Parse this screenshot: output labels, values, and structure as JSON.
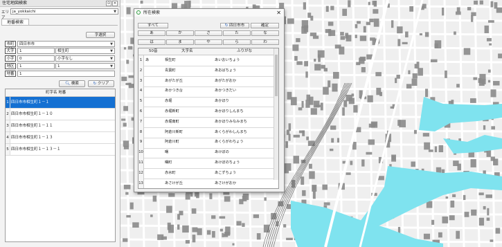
{
  "panel": {
    "title": "住宅地図検索",
    "area_label": "エリア",
    "area_value": "ja_yokkaichi",
    "tab_label": "地番検索",
    "char_select_label": "字選択",
    "rows": [
      {
        "label": "市町村",
        "value": "四日市市",
        "sub": ""
      },
      {
        "label": "大字",
        "value": "1",
        "sub": "相生町"
      },
      {
        "label": "小字",
        "value": "0",
        "sub": "小字なし"
      },
      {
        "label": "地区",
        "value": "1",
        "sub": "1"
      },
      {
        "label": "地番",
        "value": "1",
        "sub": ""
      }
    ],
    "search_label": "検索",
    "clear_label": "クリア",
    "results_header": "町字名  地番",
    "results": [
      {
        "n": "1",
        "text": "四日市市相生町１－１"
      },
      {
        "n": "2",
        "text": "四日市市相生町１－１０"
      },
      {
        "n": "3",
        "text": "四日市市相生町１－１１"
      },
      {
        "n": "4",
        "text": "四日市市相生町１－１３"
      },
      {
        "n": "5",
        "text": "四日市市相生町１－１３－１"
      }
    ]
  },
  "dialog": {
    "title": "所在検索",
    "close": "✕",
    "all_label": "すべて",
    "city_label": "四日市市",
    "confirm_label": "確定",
    "kana_row1": [
      "あ",
      "か",
      "さ",
      "た",
      "な"
    ],
    "kana_row2": [
      "は",
      "ま",
      "や",
      "ら",
      "わ"
    ],
    "grid_headers": {
      "num": "50音",
      "name": "大字名",
      "kana": "ふりがな"
    },
    "rows": [
      {
        "n": "1",
        "k": "あ",
        "name": "相生町",
        "kana": "あいおいちょう"
      },
      {
        "n": "2",
        "k": "",
        "name": "青葉町",
        "kana": "あおばちょう"
      },
      {
        "n": "3",
        "k": "",
        "name": "あがたが丘",
        "kana": "あがたがおか"
      },
      {
        "n": "4",
        "k": "",
        "name": "あかつき台",
        "kana": "あかつきだい"
      },
      {
        "n": "5",
        "k": "",
        "name": "赤堀",
        "kana": "あかほり"
      },
      {
        "n": "6",
        "k": "",
        "name": "赤堀新町",
        "kana": "あかほりしんまち"
      },
      {
        "n": "7",
        "k": "",
        "name": "赤堀南町",
        "kana": "あかほりみなみまち"
      },
      {
        "n": "8",
        "k": "",
        "name": "阿倉川新町",
        "kana": "あくらがわしんまち"
      },
      {
        "n": "9",
        "k": "",
        "name": "阿倉川町",
        "kana": "あくらがわちょう"
      },
      {
        "n": "10",
        "k": "",
        "name": "曙",
        "kana": "あけぼの"
      },
      {
        "n": "11",
        "k": "",
        "name": "曙町",
        "kana": "あけぼのちょう"
      },
      {
        "n": "12",
        "k": "",
        "name": "赤水町",
        "kana": "あこずちょう"
      },
      {
        "n": "13",
        "k": "",
        "name": "あさけが丘",
        "kana": "あさけがおか"
      }
    ]
  },
  "colors": {
    "selection": "#1470d2",
    "water": "#7fe3ef",
    "building": "#8a8a8a",
    "road": "#ffffff"
  }
}
